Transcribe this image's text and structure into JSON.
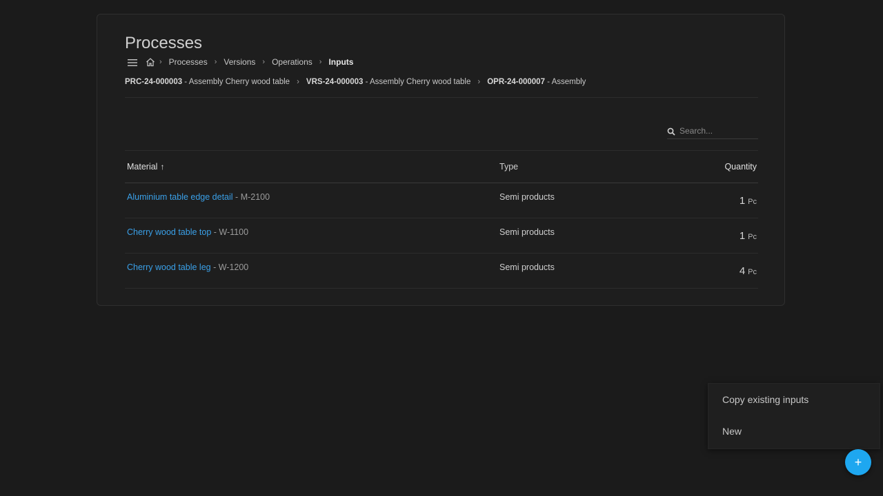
{
  "page": {
    "title": "Processes"
  },
  "breadcrumb": {
    "items": [
      "Processes",
      "Versions",
      "Operations",
      "Inputs"
    ]
  },
  "context": [
    {
      "code": "PRC-24-000003",
      "name": "Assembly Cherry wood table"
    },
    {
      "code": "VRS-24-000003",
      "name": "Assembly Cherry wood table"
    },
    {
      "code": "OPR-24-000007",
      "name": "Assembly"
    }
  ],
  "search": {
    "placeholder": "Search..."
  },
  "table": {
    "headers": {
      "material": "Material",
      "sort_indicator": "↑",
      "type": "Type",
      "quantity": "Quantity"
    },
    "rows": [
      {
        "name": "Aluminium table edge detail",
        "code": "M-2100",
        "type": "Semi products",
        "qty": "1",
        "unit": "Pc"
      },
      {
        "name": "Cherry wood table top",
        "code": "W-1100",
        "type": "Semi products",
        "qty": "1",
        "unit": "Pc"
      },
      {
        "name": "Cherry wood table leg",
        "code": "W-1200",
        "type": "Semi products",
        "qty": "4",
        "unit": "Pc"
      }
    ]
  },
  "popup": {
    "items": [
      "Copy existing inputs",
      "New"
    ]
  },
  "fab": {
    "label": "+"
  },
  "icons": {
    "menu": "menu-icon",
    "home": "home-icon",
    "search": "search-icon",
    "chevron": "chevron-right-icon",
    "add": "plus-icon"
  },
  "colors": {
    "link": "#3aa0e8",
    "accent": "#1ea7f0",
    "background": "#1b1b1b"
  }
}
